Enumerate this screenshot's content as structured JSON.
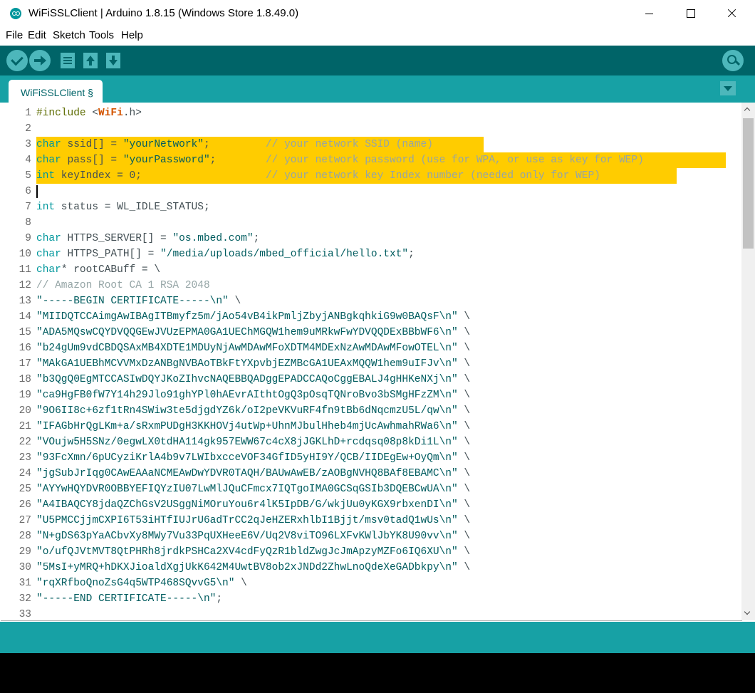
{
  "window": {
    "title": "WiFiSSLClient | Arduino 1.8.15 (Windows Store 1.8.49.0)"
  },
  "menu": {
    "items": [
      "File",
      "Edit",
      "Sketch",
      "Tools",
      "Help"
    ]
  },
  "toolbar": {
    "icons": [
      "verify-icon",
      "upload-icon",
      "new-icon",
      "open-icon",
      "save-icon",
      "serial-monitor-icon"
    ]
  },
  "tabs": {
    "active": "WiFiSSLClient §"
  },
  "colors": {
    "toolbar": "#006468",
    "tabstrip": "#17a1a5",
    "highlight": "#ffcc00",
    "keyword": "#00979c",
    "string": "#005c5f",
    "comment": "#95a5a6",
    "library": "#d35400"
  },
  "editor": {
    "lines": [
      "#include <WiFi.h>",
      "",
      "char ssid[] = \"yourNetwork\";         // your network SSID (name)",
      "char pass[] = \"yourPassword\";        // your network password (use for WPA, or use as key for WEP)",
      "int keyIndex = 0;                    // your network key Index number (needed only for WEP)",
      "",
      "int status = WL_IDLE_STATUS;",
      "",
      "char HTTPS_SERVER[] = \"os.mbed.com\";",
      "char HTTPS_PATH[] = \"/media/uploads/mbed_official/hello.txt\";",
      "char* rootCABuff = \\",
      "// Amazon Root CA 1 RSA 2048",
      "\"-----BEGIN CERTIFICATE-----\\n\" \\",
      "\"MIIDQTCCAimgAwIBAgITBmyfz5m/jAo54vB4ikPmljZbyjANBgkqhkiG9w0BAQsF\\n\" \\",
      "\"ADA5MQswCQYDVQQGEwJVUzEPMA0GA1UEChMGQW1hem9uMRkwFwYDVQQDExBBbWF6\\n\" \\",
      "\"b24gUm9vdCBDQSAxMB4XDTE1MDUyNjAwMDAwMFoXDTM4MDExNzAwMDAwMFowOTEL\\n\" \\",
      "\"MAkGA1UEBhMCVVMxDzANBgNVBAoTBkFtYXpvbjEZMBcGA1UEAxMQQW1hem9uIFJv\\n\" \\",
      "\"b3QgQ0EgMTCCASIwDQYJKoZIhvcNAQEBBQADggEPADCCAQoCggEBALJ4gHHKeNXj\\n\" \\",
      "\"ca9HgFB0fW7Y14h29Jlo91ghYPl0hAEvrAIthtOgQ3pOsqTQNroBvo3bSMgHFzZM\\n\" \\",
      "\"9O6II8c+6zf1tRn4SWiw3te5djgdYZ6k/oI2peVKVuRF4fn9tBb6dNqcmzU5L/qw\\n\" \\",
      "\"IFAGbHrQgLKm+a/sRxmPUDgH3KKHOVj4utWp+UhnMJbulHheb4mjUcAwhmahRWa6\\n\" \\",
      "\"VOujw5H5SNz/0egwLX0tdHA114gk957EWW67c4cX8jJGKLhD+rcdqsq08p8kDi1L\\n\" \\",
      "\"93FcXmn/6pUCyziKrlA4b9v7LWIbxcceVOF34GfID5yHI9Y/QCB/IIDEgEw+OyQm\\n\" \\",
      "\"jgSubJrIqg0CAwEAAaNCMEAwDwYDVR0TAQH/BAUwAwEB/zAOBgNVHQ8BAf8EBAMC\\n\" \\",
      "\"AYYwHQYDVR0OBBYEFIQYzIU07LwMlJQuCFmcx7IQTgoIMA0GCSqGSIb3DQEBCwUA\\n\" \\",
      "\"A4IBAQCY8jdaQZChGsV2USggNiMOruYou6r4lK5IpDB/G/wkjUu0yKGX9rbxenDI\\n\" \\",
      "\"U5PMCCjjmCXPI6T53iHTfIUJrU6adTrCC2qJeHZERxhlbI1Bjjt/msv0tadQ1wUs\\n\" \\",
      "\"N+gDS63pYaACbvXy8MWy7Vu33PqUXHeeE6V/Uq2V8viTO96LXFvKWlJbYK8U90vv\\n\" \\",
      "\"o/ufQJVtMVT8QtPHRh8jrdkPSHCa2XV4cdFyQzR1bldZwgJcJmApzyMZFo6IQ6XU\\n\" \\",
      "\"5MsI+yMRQ+hDKXJioaldXgjUkK642M4UwtBV8ob2xJNDd2ZhwLnoQdeXeGADbkpy\\n\" \\",
      "\"rqXRfboQnoZsG4q5WTP468SQvvG5\\n\" \\",
      "\"-----END CERTIFICATE-----\\n\";",
      ""
    ]
  }
}
